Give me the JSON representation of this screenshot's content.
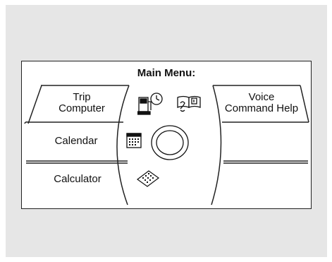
{
  "menu": {
    "title": "Main Menu:",
    "items": [
      {
        "id": "trip-computer",
        "label": "Trip\nComputer"
      },
      {
        "id": "voice-command-help",
        "label": "Voice\nCommand Help"
      },
      {
        "id": "calendar",
        "label": "Calendar"
      },
      {
        "id": "calculator",
        "label": "Calculator"
      }
    ],
    "icons": [
      {
        "name": "trip-computer-icon"
      },
      {
        "name": "help-book-icon"
      },
      {
        "name": "calendar-icon"
      },
      {
        "name": "calculator-icon"
      },
      {
        "name": "center-dial-icon"
      }
    ]
  }
}
